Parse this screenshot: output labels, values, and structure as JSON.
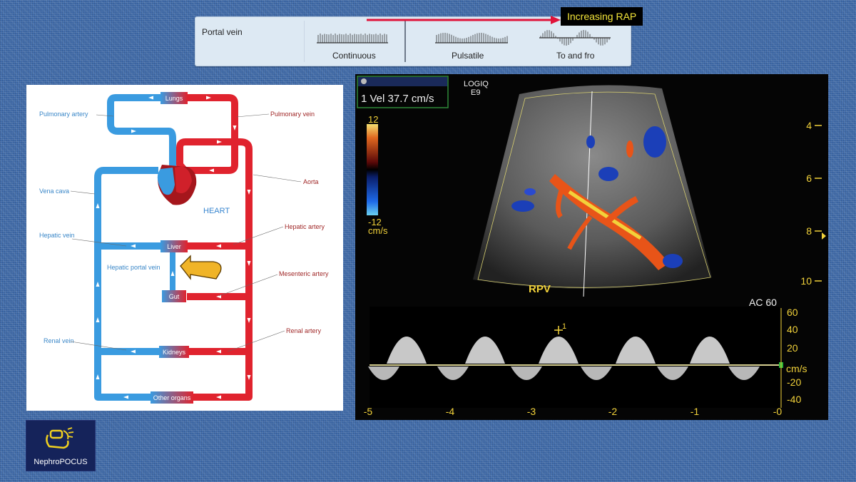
{
  "rap_banner": {
    "label": "Increasing RAP",
    "arrow_color": "#e0133a"
  },
  "portal_vein": {
    "title": "Portal vein",
    "patterns": [
      {
        "label": "Continuous"
      },
      {
        "label": "Pulsatile"
      },
      {
        "label": "To and fro"
      }
    ]
  },
  "circulation": {
    "colors": {
      "venous": "#3a9be0",
      "arterial": "#e0232e"
    },
    "organs": {
      "lungs": "Lungs",
      "liver": "Liver",
      "gut": "Gut",
      "kidneys": "Kidneys",
      "other": "Other organs",
      "heart": "HEART"
    },
    "labels": {
      "pulmonary_artery": "Pulmonary artery",
      "pulmonary_vein": "Pulmonary vein",
      "aorta": "Aorta",
      "vena_cava": "Vena cava",
      "hepatic_vein": "Hepatic vein",
      "hepatic_artery": "Hepatic artery",
      "hepatic_portal_vein": "Hepatic portal vein",
      "mesenteric_artery": "Mesenteric artery",
      "renal_vein": "Renal vein",
      "renal_artery": "Renal artery"
    }
  },
  "ultrasound": {
    "vel_readout": "1 Vel 37.7 cm/s",
    "device_line1": "LOGIQ",
    "device_line2": "E9",
    "color_scale_top": "12",
    "color_scale_bottom": "-12",
    "color_scale_unit": "cm/s",
    "region_label": "RPV",
    "depth_ticks": [
      "4",
      "6",
      "8",
      "10"
    ],
    "spectral": {
      "ac_label": "AC 60",
      "unit": "cm/s",
      "velocity_ticks": [
        "60",
        "40",
        "20",
        "-20",
        "-40"
      ],
      "time_ticks": [
        "-5",
        "-4",
        "-3",
        "-2",
        "-1",
        "-0"
      ],
      "cursor_label": "1"
    }
  },
  "logo": {
    "name": "NephroPOCUS"
  }
}
